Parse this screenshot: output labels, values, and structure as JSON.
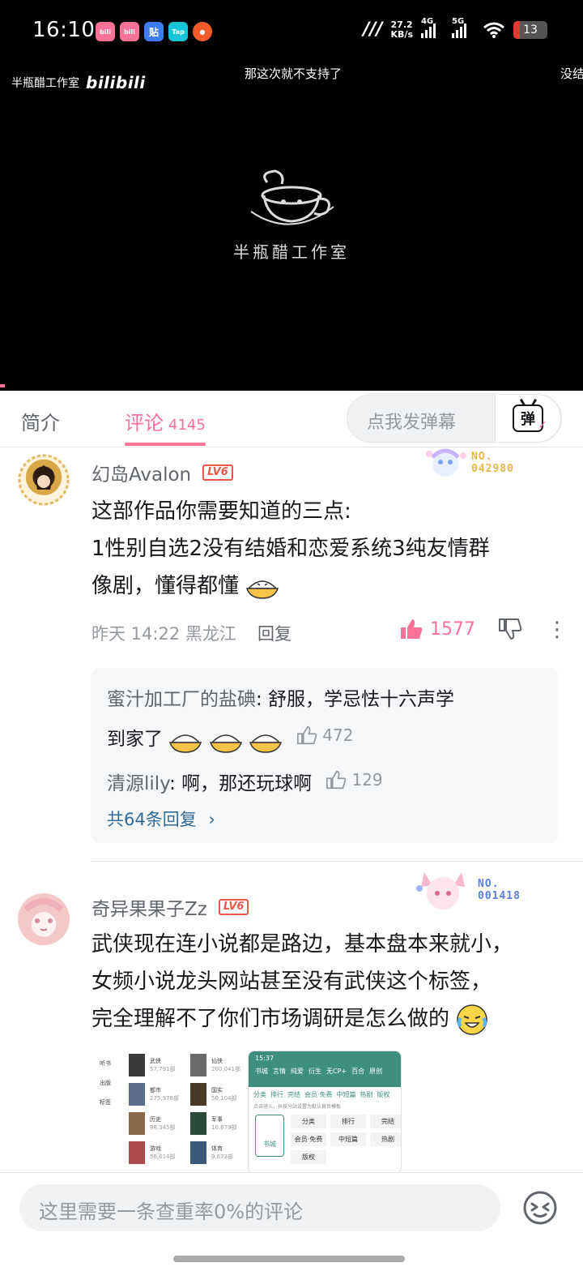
{
  "status_bar": {
    "time": "16:10",
    "net_speed": "27.2",
    "net_unit": "KB/s",
    "signal_1": "4G",
    "signal_2": "5G",
    "battery": "13",
    "app_icons": [
      "bilibili",
      "bilibili",
      "贴",
      "Tap",
      "game"
    ]
  },
  "video": {
    "watermark": "半瓶醋工作室",
    "watermark_brand": "bilibili",
    "danmaku": [
      "那这次就不支持了",
      "没结"
    ],
    "logo_title": "半瓶醋工作室"
  },
  "tabs": {
    "intro": "简介",
    "comments": "评论",
    "comments_count": "4145",
    "danmaku_placeholder": "点我发弹幕",
    "danmaku_btn_label": "弹"
  },
  "comments": [
    {
      "username": "幻岛Avalon",
      "level": "LV6",
      "badge_no": "NO.",
      "badge_num": "042980",
      "lines": [
        "这部作品你需要知道的三点:",
        "1性别自选2没有结婚和恋爱系统3纯友情群",
        "像剧，懂得都懂"
      ],
      "date": "昨天 14:22 黑龙江",
      "reply_label": "回复",
      "likes": "1577",
      "replies": [
        {
          "name": "蜜汁加工厂的盐碘",
          "text": ": 舒服，学忌怯十六声学",
          "text2": "到家了",
          "likes": "472"
        },
        {
          "name": "清源lily",
          "text": ": 啊，那还玩球啊",
          "likes": "129"
        }
      ],
      "more_replies": "共64条回复"
    },
    {
      "username": "奇异果果子Zz",
      "level": "LV6",
      "badge_no": "NO.",
      "badge_num": "001418",
      "lines": [
        "武侠现在连小说都是路边，基本盘本来就小，",
        "女频小说龙头网站甚至没有武侠这个标签，",
        "完全理解不了你们市场调研是怎么做的"
      ]
    }
  ],
  "screenshot": {
    "left_nav": [
      "听书",
      "出版",
      "标签"
    ],
    "books": [
      {
        "name": "武侠",
        "count": "57,791部"
      },
      {
        "name": "都市",
        "count": "275,978部"
      },
      {
        "name": "历史",
        "count": "98,345部"
      },
      {
        "name": "游戏",
        "count": "58,614部"
      },
      {
        "name": "仙侠",
        "count": "200,041部"
      },
      {
        "name": "国实",
        "count": "50,104部"
      },
      {
        "name": "军事",
        "count": "10,679部"
      },
      {
        "name": "体育",
        "count": "9,673部"
      }
    ],
    "time": "15:37",
    "tabs_row": [
      "书城",
      "言情",
      "纯爱",
      "衍生",
      "无CP+",
      "百合",
      "原创"
    ],
    "subtabs": [
      "分类",
      "排行",
      "完结",
      "会员·免费",
      "中短篇",
      "热剧",
      "版权"
    ],
    "hint": "点击进入，长按分站设置为默认首页模板",
    "grid": [
      "分类",
      "排行",
      "完结",
      "会员·免费",
      "中短篇",
      "热剧",
      "版权"
    ],
    "card_label": "书城"
  },
  "bottom": {
    "placeholder": "这里需要一条查重率0%的评论"
  }
}
